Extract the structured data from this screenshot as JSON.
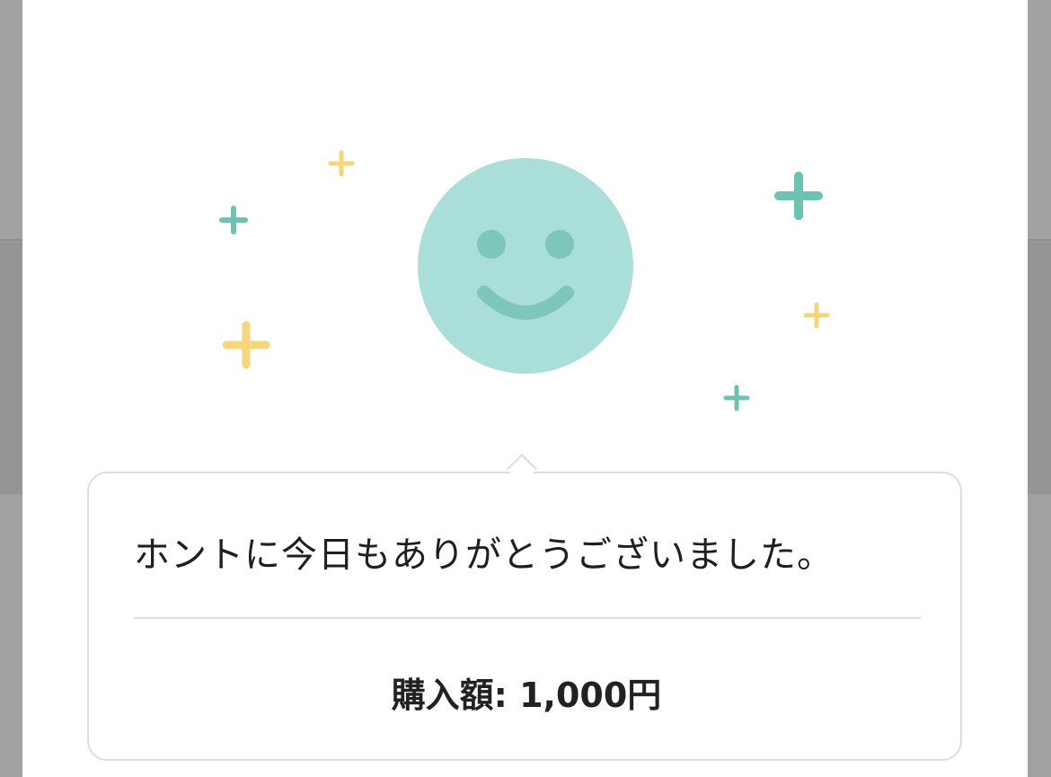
{
  "message": {
    "text": "ホントに今日もありがとうございました。"
  },
  "purchase": {
    "label": "購入額: ",
    "amount": "1,000円"
  },
  "illustration": {
    "face_icon": "smiley-face-icon",
    "sparkle_icon": "sparkle-plus-icon",
    "colors": {
      "face": "#a9dfd8",
      "face_features": "#7cc6bb",
      "sparkle_teal": "#6cc3b1",
      "sparkle_yellow": "#f7d57a"
    }
  }
}
